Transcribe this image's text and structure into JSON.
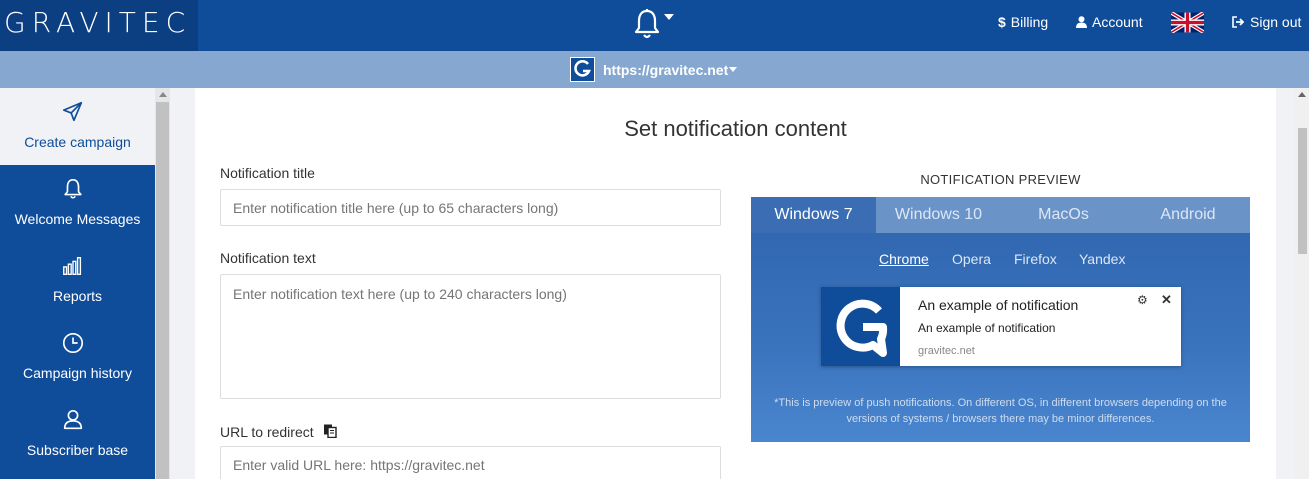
{
  "header": {
    "logo": "GRAVITEC",
    "bell_icon": "bell-icon",
    "nav": [
      {
        "icon": "dollar-icon",
        "label": "Billing"
      },
      {
        "icon": "user-icon",
        "label": "Account"
      },
      {
        "icon": "uk-flag-icon",
        "label": ""
      },
      {
        "icon": "sign-out-icon",
        "label": "Sign out"
      }
    ]
  },
  "site_bar": {
    "url": "https://gravitec.net"
  },
  "sidebar": {
    "items": [
      {
        "icon": "paper-plane-icon",
        "label": "Create campaign",
        "active": true
      },
      {
        "icon": "bell-icon",
        "label": "Welcome Messages",
        "active": false
      },
      {
        "icon": "bar-chart-icon",
        "label": "Reports",
        "active": false
      },
      {
        "icon": "clock-icon",
        "label": "Campaign history",
        "active": false
      },
      {
        "icon": "users-icon",
        "label": "Subscriber base",
        "active": false
      }
    ]
  },
  "main": {
    "heading": "Set notification content",
    "title_label": "Notification title",
    "title_placeholder": "Enter notification title here (up to 65 characters long)",
    "text_label": "Notification text",
    "text_placeholder": "Enter notification text here (up to 240 characters long)",
    "url_label": "URL to redirect",
    "url_placeholder": "Enter valid URL here: https://gravitec.net"
  },
  "preview": {
    "title": "NOTIFICATION PREVIEW",
    "os_tabs": [
      "Windows 7",
      "Windows 10",
      "MacOs",
      "Android"
    ],
    "active_os": "Windows 7",
    "browser_tabs": [
      "Chrome",
      "Opera",
      "Firefox",
      "Yandex"
    ],
    "active_browser": "Chrome",
    "notification": {
      "title": "An example of notification",
      "text": "An example of notification",
      "url": "gravitec.net"
    },
    "note": "*This is preview of push notifications. On different OS, in different browsers depending on the versions of systems / browsers there may be minor differences."
  },
  "colors": {
    "brand": "#0f4c9a",
    "site_bar": "#86a8d0",
    "preview_bg": "#3a73bd"
  }
}
